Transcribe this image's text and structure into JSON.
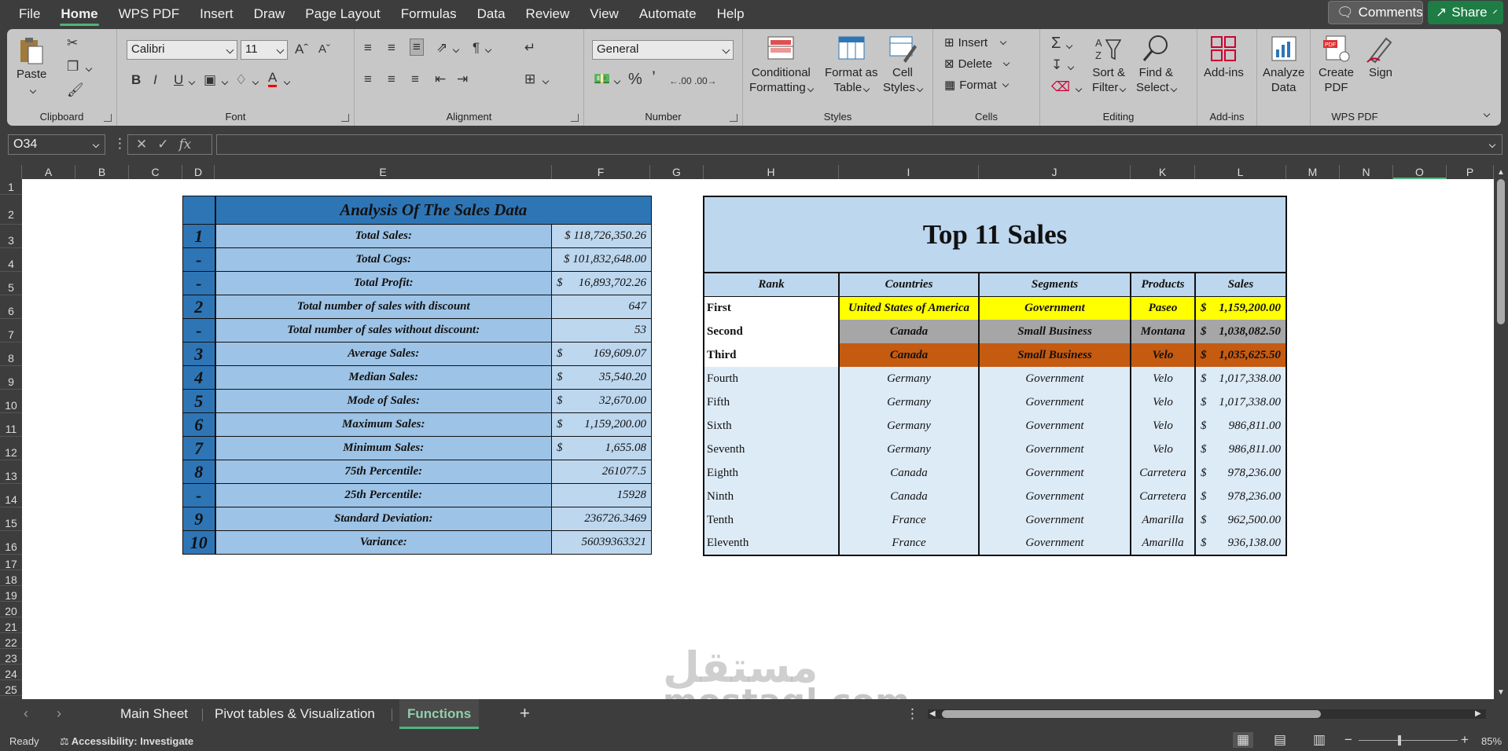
{
  "menu": {
    "items": [
      "File",
      "Home",
      "WPS PDF",
      "Insert",
      "Draw",
      "Page Layout",
      "Formulas",
      "Data",
      "Review",
      "View",
      "Automate",
      "Help"
    ],
    "active": "Home",
    "comments": "Comments",
    "share": "Share"
  },
  "ribbon": {
    "clipboard": {
      "label": "Clipboard",
      "paste": "Paste"
    },
    "font": {
      "label": "Font",
      "name": "Calibri",
      "size": "11"
    },
    "alignment": {
      "label": "Alignment"
    },
    "number": {
      "label": "Number",
      "format": "General"
    },
    "styles": {
      "label": "Styles",
      "conditional": "Conditional",
      "conditional2": "Formatting",
      "formatas": "Format as",
      "formatas2": "Table",
      "cell": "Cell",
      "cell2": "Styles"
    },
    "cells": {
      "label": "Cells",
      "insert": "Insert",
      "delete": "Delete",
      "format": "Format"
    },
    "editing": {
      "label": "Editing",
      "sort": "Sort &",
      "sort2": "Filter",
      "find": "Find &",
      "find2": "Select"
    },
    "addins": {
      "label": "Add-ins",
      "btn": "Add-ins"
    },
    "analyze": {
      "btn": "Analyze",
      "btn2": "Data"
    },
    "wps": {
      "label": "WPS PDF",
      "create": "Create",
      "create2": "PDF",
      "sign": "Sign"
    }
  },
  "formula_bar": {
    "cell_ref": "O34",
    "formula": ""
  },
  "columns": [
    "A",
    "B",
    "C",
    "D",
    "E",
    "F",
    "G",
    "H",
    "I",
    "J",
    "K",
    "L",
    "M",
    "N",
    "O",
    "P"
  ],
  "rows": [
    "1",
    "2",
    "3",
    "4",
    "5",
    "6",
    "7",
    "8",
    "9",
    "10",
    "11",
    "12",
    "13",
    "14",
    "15",
    "16",
    "17",
    "18",
    "19",
    "20",
    "21",
    "22",
    "23",
    "24",
    "25"
  ],
  "analysis": {
    "title": "Analysis Of The Sales Data",
    "rows": [
      {
        "idx": "1",
        "label": "Total Sales:",
        "dollar": "",
        "value": "$ 118,726,350.26"
      },
      {
        "idx": "-",
        "label": "Total Cogs:",
        "dollar": "",
        "value": "$ 101,832,648.00"
      },
      {
        "idx": "-",
        "label": "Total Profit:",
        "dollar": "$",
        "value": "16,893,702.26"
      },
      {
        "idx": "2",
        "label": "Total number of sales with discount",
        "dollar": "",
        "value": "647"
      },
      {
        "idx": "-",
        "label": "Total number of sales without discount:",
        "dollar": "",
        "value": "53"
      },
      {
        "idx": "3",
        "label": "Average Sales:",
        "dollar": "$",
        "value": "169,609.07"
      },
      {
        "idx": "4",
        "label": "Median Sales:",
        "dollar": "$",
        "value": "35,540.20"
      },
      {
        "idx": "5",
        "label": "Mode of Sales:",
        "dollar": "$",
        "value": "32,670.00"
      },
      {
        "idx": "6",
        "label": "Maximum Sales:",
        "dollar": "$",
        "value": "1,159,200.00"
      },
      {
        "idx": "7",
        "label": "Minimum Sales:",
        "dollar": "$",
        "value": "1,655.08"
      },
      {
        "idx": "8",
        "label": "75th Percentile:",
        "dollar": "",
        "value": "261077.5"
      },
      {
        "idx": "-",
        "label": "25th Percentile:",
        "dollar": "",
        "value": "15928"
      },
      {
        "idx": "9",
        "label": "Standard Deviation:",
        "dollar": "",
        "value": "236726.3469"
      },
      {
        "idx": "10",
        "label": "Variance:",
        "dollar": "",
        "value": "56039363321"
      }
    ]
  },
  "top_sales": {
    "title": "Top 11 Sales",
    "headers": [
      "Rank",
      "Countries",
      "Segments",
      "Products",
      "Sales"
    ],
    "rows": [
      {
        "rank": "First",
        "country": "United States of America",
        "segment": "Government",
        "product": "Paseo",
        "dollar": "$",
        "sales": "1,159,200.00"
      },
      {
        "rank": "Second",
        "country": "Canada",
        "segment": "Small Business",
        "product": "Montana",
        "dollar": "$",
        "sales": "1,038,082.50"
      },
      {
        "rank": "Third",
        "country": "Canada",
        "segment": "Small Business",
        "product": "Velo",
        "dollar": "$",
        "sales": "1,035,625.50"
      },
      {
        "rank": "Fourth",
        "country": "Germany",
        "segment": "Government",
        "product": "Velo",
        "dollar": "$",
        "sales": "1,017,338.00"
      },
      {
        "rank": "Fifth",
        "country": "Germany",
        "segment": "Government",
        "product": "Velo",
        "dollar": "$",
        "sales": "1,017,338.00"
      },
      {
        "rank": "Sixth",
        "country": "Germany",
        "segment": "Government",
        "product": "Velo",
        "dollar": "$",
        "sales": "986,811.00"
      },
      {
        "rank": "Seventh",
        "country": "Germany",
        "segment": "Government",
        "product": "Velo",
        "dollar": "$",
        "sales": "986,811.00"
      },
      {
        "rank": "Eighth",
        "country": "Canada",
        "segment": "Government",
        "product": "Carretera",
        "dollar": "$",
        "sales": "978,236.00"
      },
      {
        "rank": "Ninth",
        "country": "Canada",
        "segment": "Government",
        "product": "Carretera",
        "dollar": "$",
        "sales": "978,236.00"
      },
      {
        "rank": "Tenth",
        "country": "France",
        "segment": "Government",
        "product": "Amarilla",
        "dollar": "$",
        "sales": "962,500.00"
      },
      {
        "rank": "Eleventh",
        "country": "France",
        "segment": "Government",
        "product": "Amarilla",
        "dollar": "$",
        "sales": "936,138.00"
      }
    ]
  },
  "sheet_tabs": {
    "items": [
      "Main Sheet",
      "Pivot tables & Visualization",
      "Functions"
    ],
    "active": "Functions"
  },
  "status": {
    "ready": "Ready",
    "accessibility": "Accessibility: Investigate",
    "zoom": "85%"
  },
  "watermark": {
    "arabic": "مستقل",
    "latin": "mostaql.com"
  },
  "colors": {
    "accent": "#4fb57a",
    "title_blue": "#2e75b6",
    "light_blue": "#bdd7ee",
    "first": "#ffff00",
    "second": "#a6a6a6",
    "third": "#c55a11"
  }
}
